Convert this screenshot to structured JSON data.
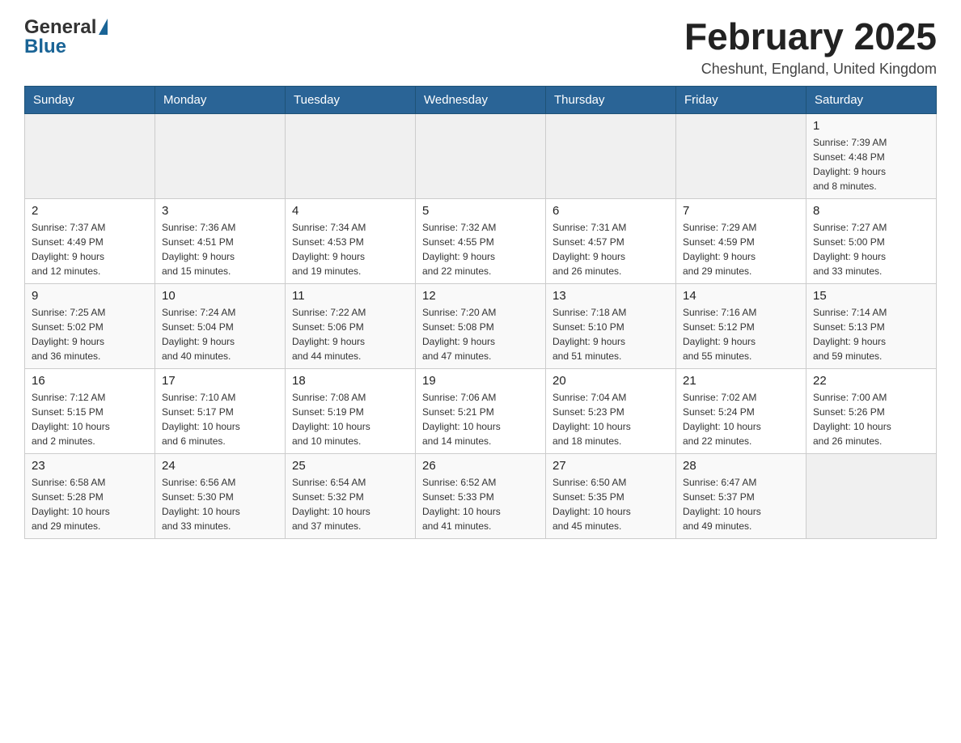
{
  "header": {
    "title": "February 2025",
    "location": "Cheshunt, England, United Kingdom",
    "logo_general": "General",
    "logo_blue": "Blue"
  },
  "weekdays": [
    "Sunday",
    "Monday",
    "Tuesday",
    "Wednesday",
    "Thursday",
    "Friday",
    "Saturday"
  ],
  "weeks": [
    [
      {
        "day": "",
        "info": ""
      },
      {
        "day": "",
        "info": ""
      },
      {
        "day": "",
        "info": ""
      },
      {
        "day": "",
        "info": ""
      },
      {
        "day": "",
        "info": ""
      },
      {
        "day": "",
        "info": ""
      },
      {
        "day": "1",
        "info": "Sunrise: 7:39 AM\nSunset: 4:48 PM\nDaylight: 9 hours\nand 8 minutes."
      }
    ],
    [
      {
        "day": "2",
        "info": "Sunrise: 7:37 AM\nSunset: 4:49 PM\nDaylight: 9 hours\nand 12 minutes."
      },
      {
        "day": "3",
        "info": "Sunrise: 7:36 AM\nSunset: 4:51 PM\nDaylight: 9 hours\nand 15 minutes."
      },
      {
        "day": "4",
        "info": "Sunrise: 7:34 AM\nSunset: 4:53 PM\nDaylight: 9 hours\nand 19 minutes."
      },
      {
        "day": "5",
        "info": "Sunrise: 7:32 AM\nSunset: 4:55 PM\nDaylight: 9 hours\nand 22 minutes."
      },
      {
        "day": "6",
        "info": "Sunrise: 7:31 AM\nSunset: 4:57 PM\nDaylight: 9 hours\nand 26 minutes."
      },
      {
        "day": "7",
        "info": "Sunrise: 7:29 AM\nSunset: 4:59 PM\nDaylight: 9 hours\nand 29 minutes."
      },
      {
        "day": "8",
        "info": "Sunrise: 7:27 AM\nSunset: 5:00 PM\nDaylight: 9 hours\nand 33 minutes."
      }
    ],
    [
      {
        "day": "9",
        "info": "Sunrise: 7:25 AM\nSunset: 5:02 PM\nDaylight: 9 hours\nand 36 minutes."
      },
      {
        "day": "10",
        "info": "Sunrise: 7:24 AM\nSunset: 5:04 PM\nDaylight: 9 hours\nand 40 minutes."
      },
      {
        "day": "11",
        "info": "Sunrise: 7:22 AM\nSunset: 5:06 PM\nDaylight: 9 hours\nand 44 minutes."
      },
      {
        "day": "12",
        "info": "Sunrise: 7:20 AM\nSunset: 5:08 PM\nDaylight: 9 hours\nand 47 minutes."
      },
      {
        "day": "13",
        "info": "Sunrise: 7:18 AM\nSunset: 5:10 PM\nDaylight: 9 hours\nand 51 minutes."
      },
      {
        "day": "14",
        "info": "Sunrise: 7:16 AM\nSunset: 5:12 PM\nDaylight: 9 hours\nand 55 minutes."
      },
      {
        "day": "15",
        "info": "Sunrise: 7:14 AM\nSunset: 5:13 PM\nDaylight: 9 hours\nand 59 minutes."
      }
    ],
    [
      {
        "day": "16",
        "info": "Sunrise: 7:12 AM\nSunset: 5:15 PM\nDaylight: 10 hours\nand 2 minutes."
      },
      {
        "day": "17",
        "info": "Sunrise: 7:10 AM\nSunset: 5:17 PM\nDaylight: 10 hours\nand 6 minutes."
      },
      {
        "day": "18",
        "info": "Sunrise: 7:08 AM\nSunset: 5:19 PM\nDaylight: 10 hours\nand 10 minutes."
      },
      {
        "day": "19",
        "info": "Sunrise: 7:06 AM\nSunset: 5:21 PM\nDaylight: 10 hours\nand 14 minutes."
      },
      {
        "day": "20",
        "info": "Sunrise: 7:04 AM\nSunset: 5:23 PM\nDaylight: 10 hours\nand 18 minutes."
      },
      {
        "day": "21",
        "info": "Sunrise: 7:02 AM\nSunset: 5:24 PM\nDaylight: 10 hours\nand 22 minutes."
      },
      {
        "day": "22",
        "info": "Sunrise: 7:00 AM\nSunset: 5:26 PM\nDaylight: 10 hours\nand 26 minutes."
      }
    ],
    [
      {
        "day": "23",
        "info": "Sunrise: 6:58 AM\nSunset: 5:28 PM\nDaylight: 10 hours\nand 29 minutes."
      },
      {
        "day": "24",
        "info": "Sunrise: 6:56 AM\nSunset: 5:30 PM\nDaylight: 10 hours\nand 33 minutes."
      },
      {
        "day": "25",
        "info": "Sunrise: 6:54 AM\nSunset: 5:32 PM\nDaylight: 10 hours\nand 37 minutes."
      },
      {
        "day": "26",
        "info": "Sunrise: 6:52 AM\nSunset: 5:33 PM\nDaylight: 10 hours\nand 41 minutes."
      },
      {
        "day": "27",
        "info": "Sunrise: 6:50 AM\nSunset: 5:35 PM\nDaylight: 10 hours\nand 45 minutes."
      },
      {
        "day": "28",
        "info": "Sunrise: 6:47 AM\nSunset: 5:37 PM\nDaylight: 10 hours\nand 49 minutes."
      },
      {
        "day": "",
        "info": ""
      }
    ]
  ]
}
